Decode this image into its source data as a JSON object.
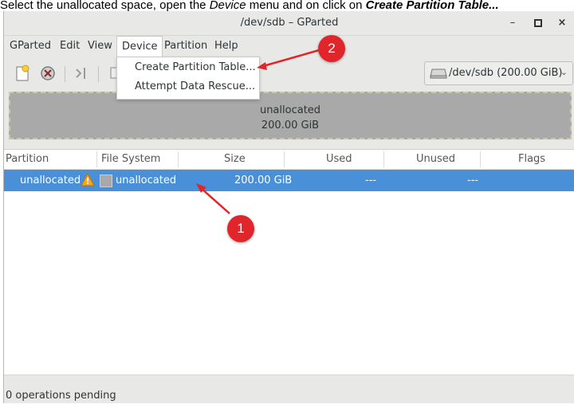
{
  "instruction": {
    "part1": "Select the unallocated space, open the ",
    "device_word": "Device",
    "part2": " menu and on click on ",
    "action": "Create Partition Table..."
  },
  "window": {
    "title": "/dev/sdb – GParted"
  },
  "window_controls": {
    "minimize": "–",
    "maximize": "□",
    "close": "×"
  },
  "menubar": [
    "GParted",
    "Edit",
    "View",
    "Device",
    "Partition",
    "Help"
  ],
  "device_menu": {
    "items": [
      "Create Partition Table...",
      "Attempt Data Rescue..."
    ]
  },
  "device_selector": {
    "label": "/dev/sdb  (200.00 GiB)",
    "icon": "disk-icon"
  },
  "disk_map": {
    "label": "unallocated",
    "size": "200.00 GiB",
    "color": "#a9a9a9"
  },
  "table": {
    "headers": [
      "Partition",
      "File System",
      "Size",
      "Used",
      "Unused",
      "Flags"
    ],
    "rows": [
      {
        "partition": "unallocated",
        "warning_icon": "warning-icon",
        "filesystem": "unallocated",
        "size": "200.00 GiB",
        "used": "---",
        "unused": "---",
        "flags": ""
      }
    ],
    "selection_color": "#4a90d9"
  },
  "status": {
    "text": "0 operations pending"
  },
  "callouts": [
    "1",
    "2"
  ],
  "colors": {
    "callout": "#e0262a",
    "highlight": "#4a90d9"
  }
}
